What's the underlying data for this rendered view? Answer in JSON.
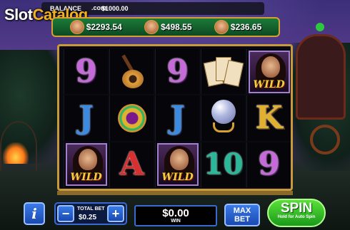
{
  "watermark": {
    "part1": "Slot",
    "part2": "Catalog",
    "dotcom": ".com"
  },
  "header": {
    "balance_label": "BALANCE",
    "balance_value": "$1000.00"
  },
  "jackpots": [
    {
      "value": "$2293.54"
    },
    {
      "value": "$498.55"
    },
    {
      "value": "$236.65"
    }
  ],
  "reels": {
    "row1": [
      "9",
      "guitar",
      "9",
      "tarot",
      "WILD"
    ],
    "row2": [
      "J",
      "brooch",
      "J",
      "crystal-ball",
      "K"
    ],
    "row3": [
      "WILD",
      "A",
      "WILD",
      "10",
      "9"
    ]
  },
  "wild_label": "WILD",
  "controls": {
    "info_label": "i",
    "minus_label": "−",
    "plus_label": "+",
    "total_bet_label": "TOTAL BET",
    "total_bet_value": "$0.25",
    "win_value": "$0.00",
    "win_label": "WIN",
    "max_bet_line1": "MAX",
    "max_bet_line2": "BET",
    "spin_label": "SPIN",
    "spin_sub": "Hold for Auto Spin"
  },
  "colors": {
    "frame_gold": "#c89a3a",
    "spin_green": "#2ec840",
    "button_blue": "#2a5ad0"
  }
}
